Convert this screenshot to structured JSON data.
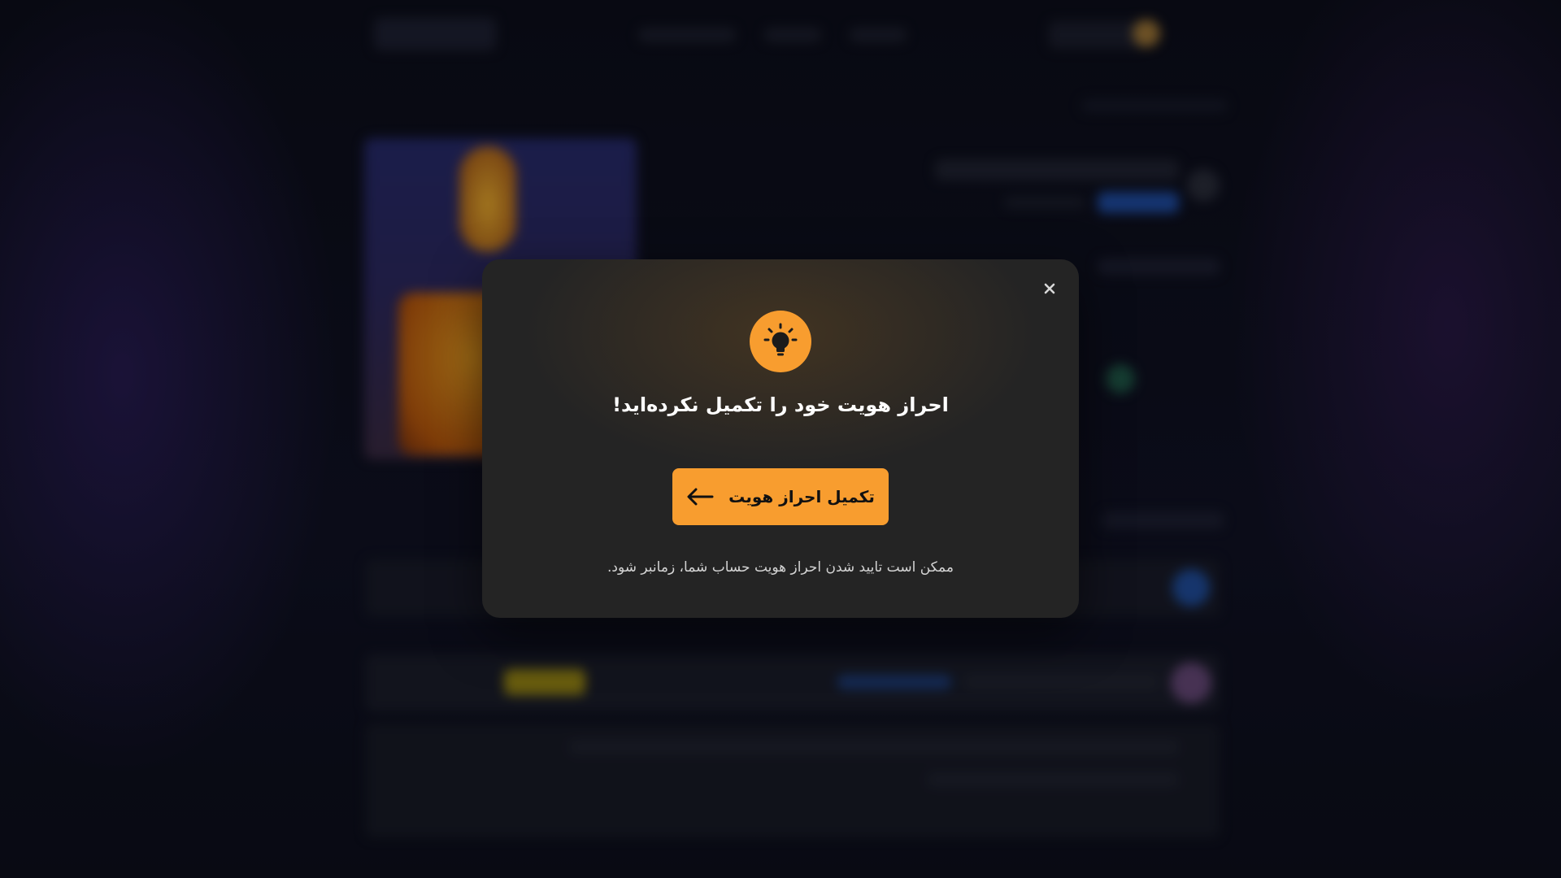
{
  "modal": {
    "title": "احراز هویت خود را تکمیل نکرده‌اید!",
    "cta_label": "تکمیل احراز هویت",
    "note": "ممکن است تایید شدن احراز هویت حساب شما، زمانبر شود.",
    "icon": "lightbulb-icon",
    "close_icon": "close-icon",
    "accent_color": "#f89d2f",
    "background_color": "#242424"
  }
}
